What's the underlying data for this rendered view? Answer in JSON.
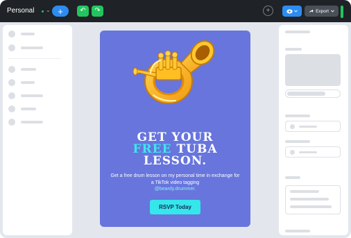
{
  "topbar": {
    "workspace_name": "Personal",
    "add_label": "+",
    "undo_label": "↶",
    "redo_label": "↷",
    "add_element_label": "+",
    "export_label": "Export",
    "colors": {
      "bar": "#1f2226",
      "accent": "#2d8cf0",
      "green": "#22c55e"
    }
  },
  "left_panel": {
    "items": [
      "placeholder",
      "placeholder",
      "placeholder",
      "placeholder",
      "placeholder",
      "placeholder",
      "placeholder"
    ]
  },
  "poster": {
    "headline": {
      "line1": "GET YOUR",
      "free_word": "FREE",
      "line2_rest": " TUBA",
      "line3": "LESSON."
    },
    "body": "Get a free drum lesson on my personal time in exchange for a TikTok video tagging",
    "handle": "@beardy.drummer.",
    "cta_label": "RSVP Today",
    "colors": {
      "background": "#6775dd",
      "highlight": "#3fe6f0",
      "cta": "#35e6ea"
    },
    "image": "tuba-illustration"
  }
}
